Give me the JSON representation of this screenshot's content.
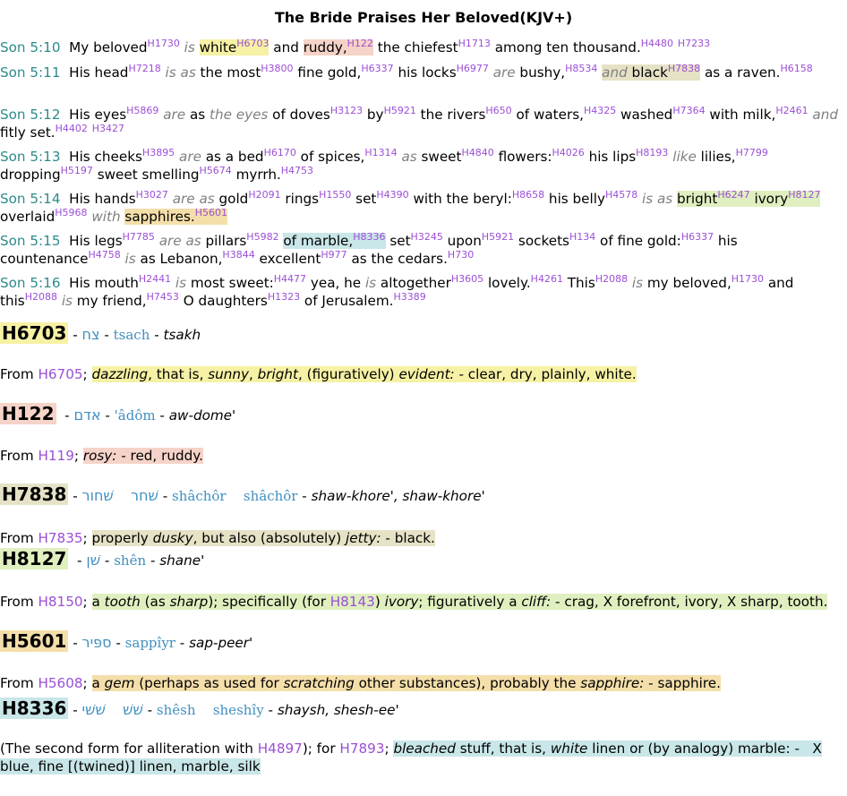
{
  "title": "The Bride Praises Her Beloved(KJV+)",
  "verses": [
    {
      "ref": "Son 5:10"
    },
    {
      "ref": "Son 5:11"
    },
    {
      "ref": "Son 5:12"
    },
    {
      "ref": "Son 5:13"
    },
    {
      "ref": "Son 5:14"
    },
    {
      "ref": "Son 5:15"
    },
    {
      "ref": "Son 5:16"
    }
  ],
  "lexicon": [
    {
      "num": "H6703",
      "heb": "צח",
      "translit": "tsach",
      "pron": "tsakh",
      "from": "H6705",
      "color": "#f6f1a4"
    },
    {
      "num": "H122",
      "heb": "אדם",
      "translit": "'âdôm",
      "pron": "aw-dome'",
      "from": "H119",
      "color": "#f6d3c8"
    },
    {
      "num": "H7838",
      "heb": "שׁחר",
      "heb2": "שׁחור",
      "translit": "shâchôr",
      "translit2": "shâchôr",
      "pron": "shaw-khore', shaw-khore'",
      "from": "H7835",
      "color": "#e6e2c6"
    },
    {
      "num": "H8127",
      "heb": "שׁן",
      "translit": "shên",
      "pron": "shane'",
      "from": "H8150",
      "also": "H8143",
      "color": "#e0efbf"
    },
    {
      "num": "H5601",
      "heb": "ספּיר",
      "translit": "sappîyr",
      "pron": "sap-peer'",
      "from": "H5608",
      "color": "#f4deaa"
    },
    {
      "num": "H8336",
      "heb": "שׁשׁ",
      "heb2": "שׁשׁי",
      "translit": "shêsh",
      "translit2": "sheshîy",
      "pron": "shaysh, shesh-ee'",
      "from": "H4897",
      "also": "H7893",
      "color": "#c9e6e8"
    }
  ]
}
